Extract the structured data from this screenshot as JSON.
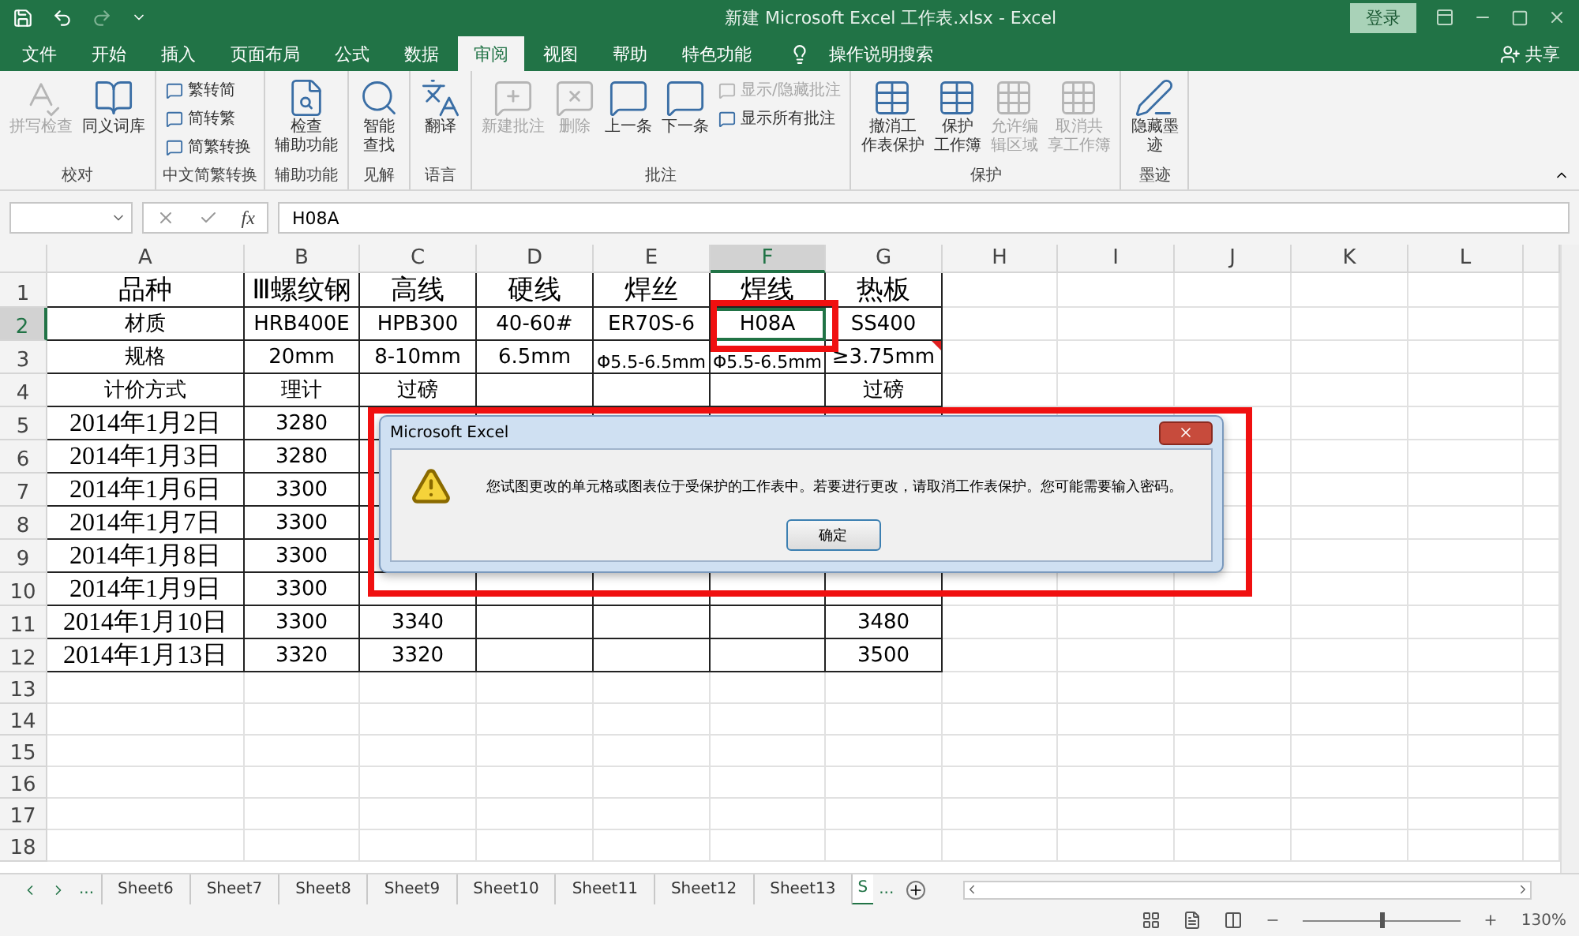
{
  "title_bar": {
    "title": "新建 Microsoft Excel 工作表.xlsx  -  Excel",
    "login": "登录"
  },
  "menu_tabs": [
    {
      "label": "文件",
      "selected": false
    },
    {
      "label": "开始",
      "selected": false
    },
    {
      "label": "插入",
      "selected": false
    },
    {
      "label": "页面布局",
      "selected": false
    },
    {
      "label": "公式",
      "selected": false
    },
    {
      "label": "数据",
      "selected": false
    },
    {
      "label": "审阅",
      "selected": true
    },
    {
      "label": "视图",
      "selected": false
    },
    {
      "label": "帮助",
      "selected": false
    },
    {
      "label": "特色功能",
      "selected": false
    }
  ],
  "tell_me": "操作说明搜索",
  "share": "共享",
  "ribbon_groups": [
    {
      "label": "校对",
      "buttons": [
        {
          "kind": "large",
          "lines": [
            "拼写检查"
          ],
          "disabled": true
        },
        {
          "kind": "large",
          "lines": [
            "同义词库"
          ],
          "disabled": false
        }
      ]
    },
    {
      "label": "中文简繁转换",
      "buttons": [
        {
          "kind": "small",
          "lines": [
            "繁转简"
          ],
          "disabled": false
        },
        {
          "kind": "small",
          "lines": [
            "简转繁"
          ],
          "disabled": false
        },
        {
          "kind": "small",
          "lines": [
            "简繁转换"
          ],
          "disabled": false
        }
      ]
    },
    {
      "label": "辅助功能",
      "buttons": [
        {
          "kind": "large",
          "lines": [
            "检查",
            "辅助功能"
          ],
          "disabled": false
        }
      ]
    },
    {
      "label": "见解",
      "buttons": [
        {
          "kind": "large",
          "lines": [
            "智能",
            "查找"
          ],
          "disabled": false
        }
      ]
    },
    {
      "label": "语言",
      "buttons": [
        {
          "kind": "large",
          "lines": [
            "翻译"
          ],
          "disabled": false
        }
      ]
    },
    {
      "label": "批注",
      "buttons": [
        {
          "kind": "large",
          "lines": [
            "新建批注"
          ],
          "disabled": true
        },
        {
          "kind": "large",
          "lines": [
            "删除"
          ],
          "disabled": true
        },
        {
          "kind": "large",
          "lines": [
            "上一条"
          ],
          "disabled": false
        },
        {
          "kind": "large",
          "lines": [
            "下一条"
          ],
          "disabled": false
        },
        {
          "kind": "small",
          "lines": [
            "显示/隐藏批注"
          ],
          "disabled": true
        },
        {
          "kind": "small",
          "lines": [
            "显示所有批注"
          ],
          "disabled": false
        }
      ]
    },
    {
      "label": "保护",
      "buttons": [
        {
          "kind": "large",
          "lines": [
            "撤消工",
            "作表保护"
          ],
          "disabled": false
        },
        {
          "kind": "large",
          "lines": [
            "保护",
            "工作簿"
          ],
          "disabled": false
        },
        {
          "kind": "large",
          "lines": [
            "允许编",
            "辑区域"
          ],
          "disabled": true
        },
        {
          "kind": "large",
          "lines": [
            "取消共",
            "享工作簿"
          ],
          "disabled": true
        }
      ]
    },
    {
      "label": "墨迹",
      "buttons": [
        {
          "kind": "large",
          "lines": [
            "隐藏墨",
            "迹"
          ],
          "disabled": false
        }
      ]
    }
  ],
  "formula_bar": {
    "fx": "fx",
    "formula": "H08A"
  },
  "columns": [
    {
      "label": "A",
      "selected": false
    },
    {
      "label": "B",
      "selected": false
    },
    {
      "label": "C",
      "selected": false
    },
    {
      "label": "D",
      "selected": false
    },
    {
      "label": "E",
      "selected": false
    },
    {
      "label": "F",
      "selected": true
    },
    {
      "label": "G",
      "selected": false
    },
    {
      "label": "H",
      "selected": false
    },
    {
      "label": "I",
      "selected": false
    },
    {
      "label": "J",
      "selected": false
    },
    {
      "label": "K",
      "selected": false
    },
    {
      "label": "L",
      "selected": false
    }
  ],
  "rows": [
    {
      "number": "1",
      "selected": false,
      "cells": [
        "品种",
        "Ⅲ螺纹钢",
        "高线",
        "硬线",
        "焊丝",
        "焊线",
        "热板"
      ]
    },
    {
      "number": "2",
      "selected": true,
      "cells": [
        "材质",
        "HRB400E",
        "HPB300",
        "40-60#",
        "ER70S-6",
        "H08A",
        "SS400"
      ]
    },
    {
      "number": "3",
      "selected": false,
      "cells": [
        "规格",
        "20mm",
        "8-10mm",
        "6.5mm",
        "Φ5.5-6.5mm",
        "Φ5.5-6.5mm",
        "≥3.75mm"
      ],
      "comment": true
    },
    {
      "number": "4",
      "selected": false,
      "cells": [
        "计价方式",
        "理计",
        "过磅",
        null,
        null,
        null,
        "过磅"
      ]
    },
    {
      "number": "5",
      "selected": false,
      "cells": [
        "2014年1月2日",
        "3280",
        null,
        null,
        null,
        null,
        null
      ]
    },
    {
      "number": "6",
      "selected": false,
      "cells": [
        "2014年1月3日",
        "3280",
        null,
        null,
        null,
        null,
        null
      ]
    },
    {
      "number": "7",
      "selected": false,
      "cells": [
        "2014年1月6日",
        "3300",
        null,
        null,
        null,
        null,
        null
      ]
    },
    {
      "number": "8",
      "selected": false,
      "cells": [
        "2014年1月7日",
        "3300",
        null,
        null,
        null,
        null,
        null
      ]
    },
    {
      "number": "9",
      "selected": false,
      "cells": [
        "2014年1月8日",
        "3300",
        null,
        null,
        null,
        null,
        null
      ]
    },
    {
      "number": "10",
      "selected": false,
      "cells": [
        "2014年1月9日",
        "3300",
        null,
        null,
        null,
        null,
        null
      ]
    },
    {
      "number": "11",
      "selected": false,
      "cells": [
        "2014年1月10日",
        "3300",
        "3340",
        null,
        null,
        null,
        "3480"
      ]
    },
    {
      "number": "12",
      "selected": false,
      "cells": [
        "2014年1月13日",
        "3320",
        "3320",
        null,
        null,
        null,
        "3500"
      ]
    },
    {
      "number": "13",
      "selected": false
    },
    {
      "number": "14",
      "selected": false
    },
    {
      "number": "15",
      "selected": false
    },
    {
      "number": "16",
      "selected": false
    },
    {
      "number": "17",
      "selected": false
    },
    {
      "number": "18",
      "selected": false
    }
  ],
  "dialog": {
    "title": "Microsoft Excel",
    "message": "您试图更改的单元格或图表位于受保护的工作表中。若要进行更改，请取消工作表保护。您可能需要输入密码。",
    "ok": "确定"
  },
  "sheet_tabs": {
    "more_left": "...",
    "tabs": [
      {
        "label": "Sheet6",
        "selected": false
      },
      {
        "label": "Sheet7",
        "selected": false
      },
      {
        "label": "Sheet8",
        "selected": false
      },
      {
        "label": "Sheet9",
        "selected": false
      },
      {
        "label": "Sheet10",
        "selected": false
      },
      {
        "label": "Sheet11",
        "selected": false
      },
      {
        "label": "Sheet12",
        "selected": false
      },
      {
        "label": "Sheet13",
        "selected": false
      },
      {
        "label": "S",
        "selected": true
      }
    ],
    "more_right": "..."
  },
  "status_bar": {
    "zoom": "130%",
    "level": 0.5
  }
}
